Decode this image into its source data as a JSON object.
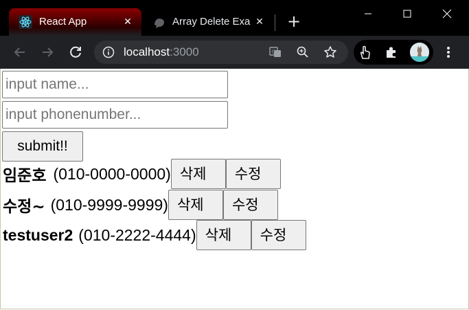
{
  "browser": {
    "active_tab_title": "React App",
    "inactive_tab_title": "Array Delete Exa",
    "url_host": "localhost",
    "url_port": ":3000"
  },
  "form": {
    "name_placeholder": "input name...",
    "phone_placeholder": "input phonenumber...",
    "submit_label": "submit!!"
  },
  "users": [
    {
      "name": "임준호",
      "phone": "(010-0000-0000)",
      "delete_label": "삭제",
      "edit_label": "수정"
    },
    {
      "name": "수정~",
      "phone": "(010-9999-9999)",
      "delete_label": "삭제",
      "edit_label": "수정"
    },
    {
      "name": "testuser2",
      "phone": "(010-2222-4444)",
      "delete_label": "삭제",
      "edit_label": "수정"
    }
  ]
}
